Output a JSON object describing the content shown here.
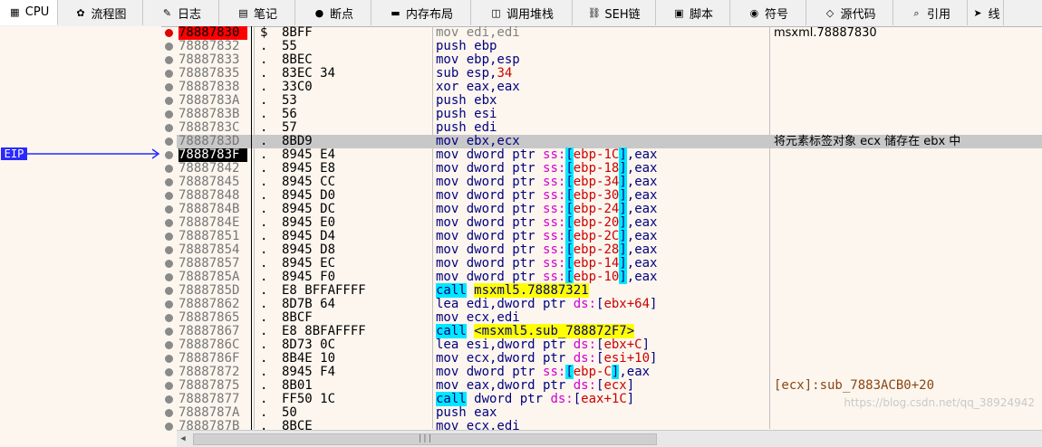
{
  "tabs": [
    {
      "label": "CPU",
      "icon": "cpu-icon",
      "glyph": "▦",
      "active": true,
      "w": 64
    },
    {
      "label": "流程图",
      "icon": "flowchart-icon",
      "glyph": "✿",
      "w": 94
    },
    {
      "label": "日志",
      "icon": "log-icon",
      "glyph": "✎",
      "w": 84
    },
    {
      "label": "笔记",
      "icon": "notes-icon",
      "glyph": "▤",
      "w": 84
    },
    {
      "label": "断点",
      "icon": "breakpoint-icon",
      "glyph": "●",
      "w": 84
    },
    {
      "label": "内存布局",
      "icon": "memory-map-icon",
      "glyph": "▬",
      "w": 110
    },
    {
      "label": "调用堆栈",
      "icon": "call-stack-icon",
      "glyph": "◫",
      "w": 112
    },
    {
      "label": "SEH链",
      "icon": "seh-chain-icon",
      "glyph": "⛓",
      "w": 92
    },
    {
      "label": "脚本",
      "icon": "script-icon",
      "glyph": "▣",
      "w": 82
    },
    {
      "label": "符号",
      "icon": "symbols-icon",
      "glyph": "◉",
      "w": 84
    },
    {
      "label": "源代码",
      "icon": "source-code-icon",
      "glyph": "◇",
      "w": 96
    },
    {
      "label": "引用",
      "icon": "references-icon",
      "glyph": "⌕",
      "w": 82
    },
    {
      "label": "线",
      "icon": "threads-icon",
      "glyph": "➤",
      "w": 40
    }
  ],
  "eip_label": "EIP",
  "rows": [
    {
      "addr": "78887830",
      "flag": "$",
      "hex": "8BFF",
      "dis": [
        [
          "dim",
          "mov edi,edi"
        ]
      ],
      "comment": "msxml.78887830",
      "bp": "active"
    },
    {
      "addr": "78887832",
      "flag": ".",
      "hex": "55",
      "dis": [
        [
          "",
          "push ebp"
        ]
      ]
    },
    {
      "addr": "78887833",
      "flag": ".",
      "hex": "8BEC",
      "dis": [
        [
          "",
          "mov ebp,esp"
        ]
      ]
    },
    {
      "addr": "78887835",
      "flag": ".",
      "hex": "83EC 34",
      "dis": [
        [
          "",
          "sub esp,"
        ],
        [
          "red",
          "34"
        ]
      ]
    },
    {
      "addr": "78887838",
      "flag": ".",
      "hex": "33C0",
      "dis": [
        [
          "",
          "xor eax,eax"
        ]
      ]
    },
    {
      "addr": "7888783A",
      "flag": ".",
      "hex": "53",
      "dis": [
        [
          "",
          "push ebx"
        ]
      ]
    },
    {
      "addr": "7888783B",
      "flag": ".",
      "hex": "56",
      "dis": [
        [
          "",
          "push esi"
        ]
      ]
    },
    {
      "addr": "7888783C",
      "flag": ".",
      "hex": "57",
      "dis": [
        [
          "",
          "push edi"
        ]
      ]
    },
    {
      "addr": "7888783D",
      "flag": ".",
      "hex": "8BD9",
      "dis": [
        [
          "",
          "mov ebx,ecx"
        ]
      ],
      "comment": "将元素标签对象 ecx 储存在 ebx 中",
      "hl": true
    },
    {
      "addr": "7888783F",
      "flag": ".",
      "hex": "8945 E4",
      "dis": [
        [
          "",
          "mov dword ptr "
        ],
        [
          "mag",
          "ss:"
        ],
        [
          "hl-cyan",
          "["
        ],
        [
          "red",
          "ebp-1C"
        ],
        [
          "hl-cyan",
          "]"
        ],
        [
          "",
          ",eax"
        ]
      ],
      "eip": true
    },
    {
      "addr": "78887842",
      "flag": ".",
      "hex": "8945 E8",
      "dis": [
        [
          "",
          "mov dword ptr "
        ],
        [
          "mag",
          "ss:"
        ],
        [
          "hl-cyan",
          "["
        ],
        [
          "red",
          "ebp-18"
        ],
        [
          "hl-cyan",
          "]"
        ],
        [
          "",
          ",eax"
        ]
      ]
    },
    {
      "addr": "78887845",
      "flag": ".",
      "hex": "8945 CC",
      "dis": [
        [
          "",
          "mov dword ptr "
        ],
        [
          "mag",
          "ss:"
        ],
        [
          "hl-cyan",
          "["
        ],
        [
          "red",
          "ebp-34"
        ],
        [
          "hl-cyan",
          "]"
        ],
        [
          "",
          ",eax"
        ]
      ]
    },
    {
      "addr": "78887848",
      "flag": ".",
      "hex": "8945 D0",
      "dis": [
        [
          "",
          "mov dword ptr "
        ],
        [
          "mag",
          "ss:"
        ],
        [
          "hl-cyan",
          "["
        ],
        [
          "red",
          "ebp-30"
        ],
        [
          "hl-cyan",
          "]"
        ],
        [
          "",
          ",eax"
        ]
      ]
    },
    {
      "addr": "7888784B",
      "flag": ".",
      "hex": "8945 DC",
      "dis": [
        [
          "",
          "mov dword ptr "
        ],
        [
          "mag",
          "ss:"
        ],
        [
          "hl-cyan",
          "["
        ],
        [
          "red",
          "ebp-24"
        ],
        [
          "hl-cyan",
          "]"
        ],
        [
          "",
          ",eax"
        ]
      ]
    },
    {
      "addr": "7888784E",
      "flag": ".",
      "hex": "8945 E0",
      "dis": [
        [
          "",
          "mov dword ptr "
        ],
        [
          "mag",
          "ss:"
        ],
        [
          "hl-cyan",
          "["
        ],
        [
          "red",
          "ebp-20"
        ],
        [
          "hl-cyan",
          "]"
        ],
        [
          "",
          ",eax"
        ]
      ]
    },
    {
      "addr": "78887851",
      "flag": ".",
      "hex": "8945 D4",
      "dis": [
        [
          "",
          "mov dword ptr "
        ],
        [
          "mag",
          "ss:"
        ],
        [
          "hl-cyan",
          "["
        ],
        [
          "red",
          "ebp-2C"
        ],
        [
          "hl-cyan",
          "]"
        ],
        [
          "",
          ",eax"
        ]
      ]
    },
    {
      "addr": "78887854",
      "flag": ".",
      "hex": "8945 D8",
      "dis": [
        [
          "",
          "mov dword ptr "
        ],
        [
          "mag",
          "ss:"
        ],
        [
          "hl-cyan",
          "["
        ],
        [
          "red",
          "ebp-28"
        ],
        [
          "hl-cyan",
          "]"
        ],
        [
          "",
          ",eax"
        ]
      ]
    },
    {
      "addr": "78887857",
      "flag": ".",
      "hex": "8945 EC",
      "dis": [
        [
          "",
          "mov dword ptr "
        ],
        [
          "mag",
          "ss:"
        ],
        [
          "hl-cyan",
          "["
        ],
        [
          "red",
          "ebp-14"
        ],
        [
          "hl-cyan",
          "]"
        ],
        [
          "",
          ",eax"
        ]
      ]
    },
    {
      "addr": "7888785A",
      "flag": ".",
      "hex": "8945 F0",
      "dis": [
        [
          "",
          "mov dword ptr "
        ],
        [
          "mag",
          "ss:"
        ],
        [
          "hl-cyan",
          "["
        ],
        [
          "red",
          "ebp-10"
        ],
        [
          "hl-cyan",
          "]"
        ],
        [
          "",
          ",eax"
        ]
      ]
    },
    {
      "addr": "7888785D",
      "flag": ".",
      "hex": "E8 BFFAFFFF",
      "dis": [
        [
          "hl-cyan",
          "call"
        ],
        [
          "",
          " "
        ],
        [
          "hl-yellow",
          "msxml5.78887321"
        ]
      ]
    },
    {
      "addr": "78887862",
      "flag": ".",
      "hex": "8D7B 64",
      "dis": [
        [
          "",
          "lea edi,dword ptr "
        ],
        [
          "mag",
          "ds:"
        ],
        [
          "",
          "["
        ],
        [
          "red",
          "ebx+64"
        ],
        [
          "",
          "]"
        ]
      ]
    },
    {
      "addr": "78887865",
      "flag": ".",
      "hex": "8BCF",
      "dis": [
        [
          "",
          "mov ecx,edi"
        ]
      ]
    },
    {
      "addr": "78887867",
      "flag": ".",
      "hex": "E8 8BFAFFFF",
      "dis": [
        [
          "hl-cyan",
          "call"
        ],
        [
          "",
          " "
        ],
        [
          "hl-yellow",
          "<msxml5.sub_788872F7>"
        ]
      ]
    },
    {
      "addr": "7888786C",
      "flag": ".",
      "hex": "8D73 0C",
      "dis": [
        [
          "",
          "lea esi,dword ptr "
        ],
        [
          "mag",
          "ds:"
        ],
        [
          "",
          "["
        ],
        [
          "red",
          "ebx+C"
        ],
        [
          "",
          "]"
        ]
      ]
    },
    {
      "addr": "7888786F",
      "flag": ".",
      "hex": "8B4E 10",
      "dis": [
        [
          "",
          "mov ecx,dword ptr "
        ],
        [
          "mag",
          "ds:"
        ],
        [
          "",
          "["
        ],
        [
          "red",
          "esi+10"
        ],
        [
          "",
          "]"
        ]
      ]
    },
    {
      "addr": "78887872",
      "flag": ".",
      "hex": "8945 F4",
      "dis": [
        [
          "",
          "mov dword ptr "
        ],
        [
          "mag",
          "ss:"
        ],
        [
          "hl-cyan",
          "["
        ],
        [
          "red",
          "ebp-C"
        ],
        [
          "hl-cyan",
          "]"
        ],
        [
          "",
          ",eax"
        ]
      ]
    },
    {
      "addr": "78887875",
      "flag": ".",
      "hex": "8B01",
      "dis": [
        [
          "",
          "mov eax,dword ptr "
        ],
        [
          "mag",
          "ds:"
        ],
        [
          "",
          "["
        ],
        [
          "red",
          "ecx"
        ],
        [
          "",
          "]"
        ]
      ],
      "comment": "[ecx]:sub_7883ACB0+20",
      "comment_brown": true
    },
    {
      "addr": "78887877",
      "flag": ".",
      "hex": "FF50 1C",
      "dis": [
        [
          "hl-cyan",
          "call"
        ],
        [
          "",
          " dword ptr "
        ],
        [
          "mag",
          "ds:"
        ],
        [
          "",
          "["
        ],
        [
          "red",
          "eax+1C"
        ],
        [
          "",
          "]"
        ]
      ]
    },
    {
      "addr": "7888787A",
      "flag": ".",
      "hex": "50",
      "dis": [
        [
          "",
          "push eax"
        ]
      ]
    },
    {
      "addr": "7888787B",
      "flag": ".",
      "hex": "8BCE",
      "dis": [
        [
          "",
          "mov ecx,edi"
        ]
      ]
    }
  ],
  "scroll_thumb_glyph": "|||",
  "scroll_left_glyph": "◀",
  "watermark": "https://blog.csdn.net/qq_38924942"
}
